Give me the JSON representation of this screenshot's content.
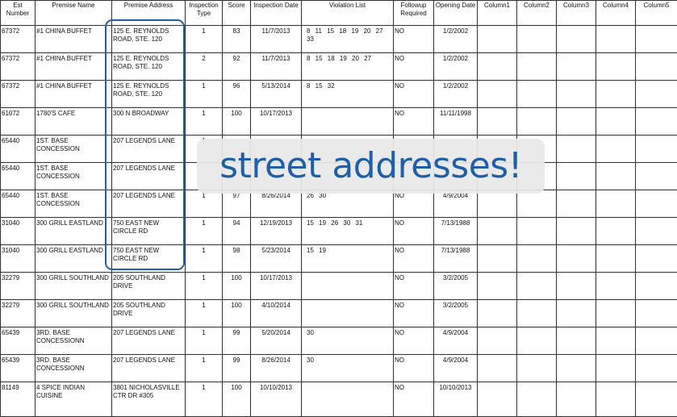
{
  "headers": [
    "Est Number",
    "Premise Name",
    "Premise Address",
    "Inspection Type",
    "Score",
    "Inspection Date",
    "Violation List",
    "Followup Required",
    "Opening Date",
    "Column1",
    "Column2",
    "Column3",
    "Column4",
    "Column5"
  ],
  "rows": [
    {
      "est": "67372",
      "name": "#1 CHINA BUFFET",
      "address": "125 E. REYNOLDS ROAD, STE. 120",
      "type": "1",
      "score": "83",
      "date": "11/7/2013",
      "violations": "8 11 15 18 19 20 27 33",
      "followup": "NO",
      "opening": "1/2/2002"
    },
    {
      "est": "67372",
      "name": "#1 CHINA BUFFET",
      "address": "125 E. REYNOLDS ROAD, STE. 120",
      "type": "2",
      "score": "92",
      "date": "11/7/2013",
      "violations": "8 15 18 19 20 27",
      "followup": "NO",
      "opening": "1/2/2002"
    },
    {
      "est": "67372",
      "name": "#1 CHINA BUFFET",
      "address": "125 E. REYNOLDS ROAD, STE. 120",
      "type": "1",
      "score": "96",
      "date": "5/13/2014",
      "violations": "8 15 32",
      "followup": "NO",
      "opening": "1/2/2002"
    },
    {
      "est": "61072",
      "name": "1780'S CAFE",
      "address": "300 N BROADWAY",
      "type": "1",
      "score": "100",
      "date": "10/17/2013",
      "violations": "",
      "followup": "NO",
      "opening": "11/11/1998"
    },
    {
      "est": "65440",
      "name": "1ST. BASE CONCESSION",
      "address": "207 LEGENDS LANE",
      "type": "1",
      "score": "",
      "date": "",
      "violations": "",
      "followup": "",
      "opening": ""
    },
    {
      "est": "65440",
      "name": "1ST. BASE CONCESSION",
      "address": "207 LEGENDS LANE",
      "type": "",
      "score": "",
      "date": "",
      "violations": "",
      "followup": "",
      "opening": ""
    },
    {
      "est": "65440",
      "name": "1ST. BASE CONCESSION",
      "address": "207 LEGENDS LANE",
      "type": "1",
      "score": "97",
      "date": "8/26/2014",
      "violations": "26 30",
      "followup": "NO",
      "opening": "4/9/2004"
    },
    {
      "est": "31040",
      "name": "300 GRILL EASTLAND",
      "address": "750 EAST NEW CIRCLE RD",
      "type": "1",
      "score": "94",
      "date": "12/19/2013",
      "violations": "15 19 26 30 31",
      "followup": "NO",
      "opening": "7/13/1988"
    },
    {
      "est": "31040",
      "name": "300 GRILL EASTLAND",
      "address": "750 EAST NEW CIRCLE RD",
      "type": "1",
      "score": "98",
      "date": "5/23/2014",
      "violations": "15 19",
      "followup": "NO",
      "opening": "7/13/1988"
    },
    {
      "est": "32279",
      "name": "300 GRILL SOUTHLAND",
      "address": "205 SOUTHLAND DRIVE",
      "type": "1",
      "score": "100",
      "date": "10/17/2013",
      "violations": "",
      "followup": "NO",
      "opening": "3/2/2005"
    },
    {
      "est": "32279",
      "name": "300 GRILL SOUTHLAND",
      "address": "205 SOUTHLAND DRIVE",
      "type": "1",
      "score": "100",
      "date": "4/10/2014",
      "violations": "",
      "followup": "NO",
      "opening": "3/2/2005"
    },
    {
      "est": "65439",
      "name": "3RD. BASE CONCESSIONN",
      "address": "207 LEGENDS LANE",
      "type": "1",
      "score": "99",
      "date": "5/20/2014",
      "violations": "30",
      "followup": "NO",
      "opening": "4/9/2004"
    },
    {
      "est": "65439",
      "name": "3RD. BASE CONCESSIONN",
      "address": "207 LEGENDS LANE",
      "type": "1",
      "score": "99",
      "date": "8/26/2014",
      "violations": "30",
      "followup": "NO",
      "opening": "4/9/2004"
    },
    {
      "est": "81149",
      "name": "4 SPICE INDIAN CUISINE",
      "address": "3801 NICHOLASVILLE CTR DR #305",
      "type": "1",
      "score": "100",
      "date": "10/10/2013",
      "violations": "",
      "followup": "NO",
      "opening": "10/10/2013"
    }
  ],
  "callout": "street addresses!",
  "colors": {
    "accent": "#1f5fa8",
    "callout_bg": "#e8e8e8"
  }
}
